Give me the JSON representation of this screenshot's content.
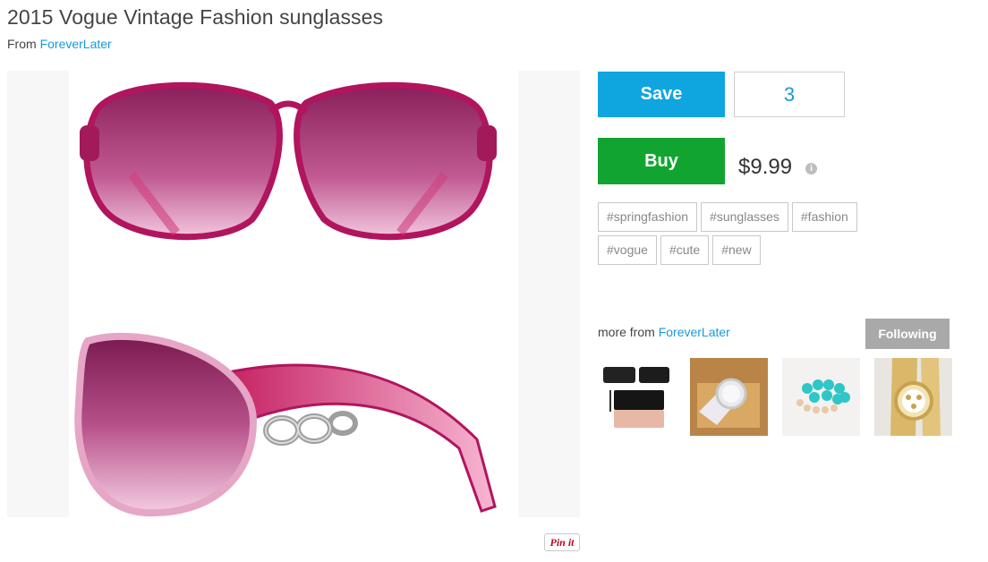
{
  "product": {
    "title": "2015 Vogue Vintage Fashion sunglasses",
    "from_label": "From",
    "seller": "ForeverLater"
  },
  "actions": {
    "save_label": "Save",
    "save_count": "3",
    "buy_label": "Buy",
    "price": "$9.99",
    "info_glyph": "i"
  },
  "tags": [
    "#springfashion",
    "#sunglasses",
    "#fashion",
    "#vogue",
    "#cute",
    "#new"
  ],
  "more_from": {
    "label": "more from",
    "seller": "ForeverLater",
    "following_label": "Following",
    "thumbnails": [
      "clutch-bag",
      "wrist-watch-boxed",
      "turquoise-bracelets",
      "gold-watch"
    ]
  },
  "pin_it_label": "Pin it",
  "colors": {
    "save": "#0fa6e0",
    "buy": "#12a431",
    "link": "#1a9ad6",
    "following": "#a9a9a9",
    "lens": "#a3326f",
    "frame": "#c2185b"
  }
}
